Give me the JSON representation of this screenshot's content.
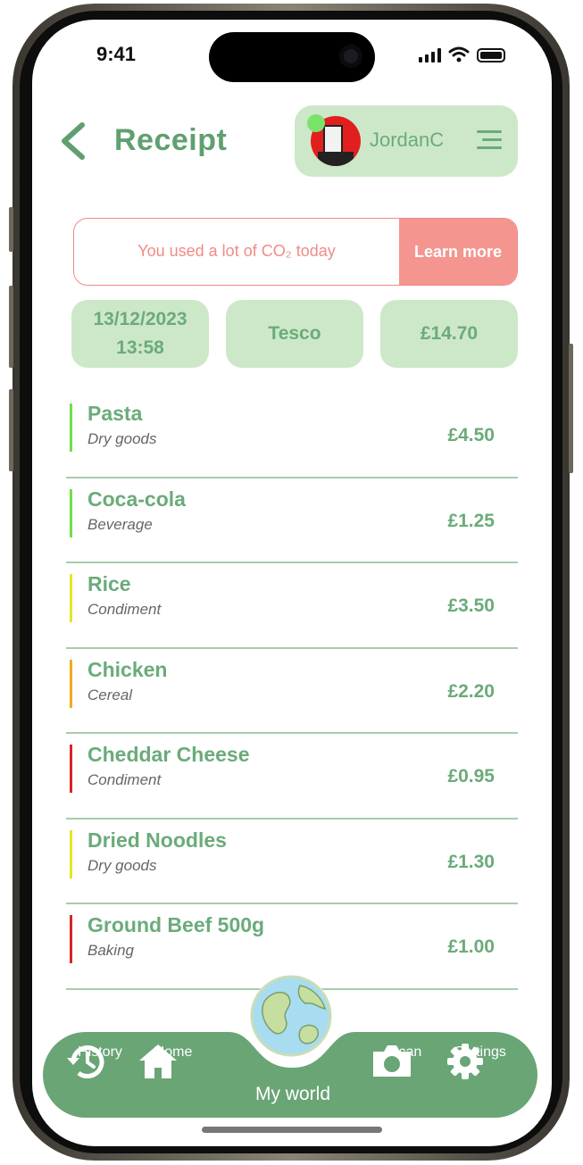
{
  "status": {
    "time": "9:41"
  },
  "header": {
    "title": "Receipt",
    "back_icon": "chevron-left-icon"
  },
  "user": {
    "name": "JordanC",
    "status_color": "#79e36a"
  },
  "alert": {
    "text": "You used a lot of CO₂ today",
    "button": "Learn more"
  },
  "summary": {
    "date": "13/12/2023",
    "time": "13:58",
    "store": "Tesco",
    "total": "£14.70"
  },
  "items": [
    {
      "name": "Pasta",
      "category": "Dry goods",
      "price": "£4.50",
      "color": "#6ee04a"
    },
    {
      "name": "Coca-cola",
      "category": "Beverage",
      "price": "£1.25",
      "color": "#6ee04a"
    },
    {
      "name": "Rice",
      "category": "Condiment",
      "price": "£3.50",
      "color": "#e4e628"
    },
    {
      "name": "Chicken",
      "category": "Cereal",
      "price": "£2.20",
      "color": "#f0ab1c"
    },
    {
      "name": "Cheddar Cheese",
      "category": "Condiment",
      "price": "£0.95",
      "color": "#d6262a"
    },
    {
      "name": "Dried Noodles",
      "category": "Dry goods",
      "price": "£1.30",
      "color": "#e4e628"
    },
    {
      "name": "Ground Beef 500g",
      "category": "Baking",
      "price": "£1.00",
      "color": "#d6262a"
    }
  ],
  "nav": {
    "history": "History",
    "home": "Home",
    "my_world": "My world",
    "scan": "Scan",
    "settings": "Settings"
  },
  "colors": {
    "accent": "#6bab7a",
    "tab_bg": "#6aa576",
    "card_bg": "#cde8c8",
    "alert": "#f4958f"
  }
}
